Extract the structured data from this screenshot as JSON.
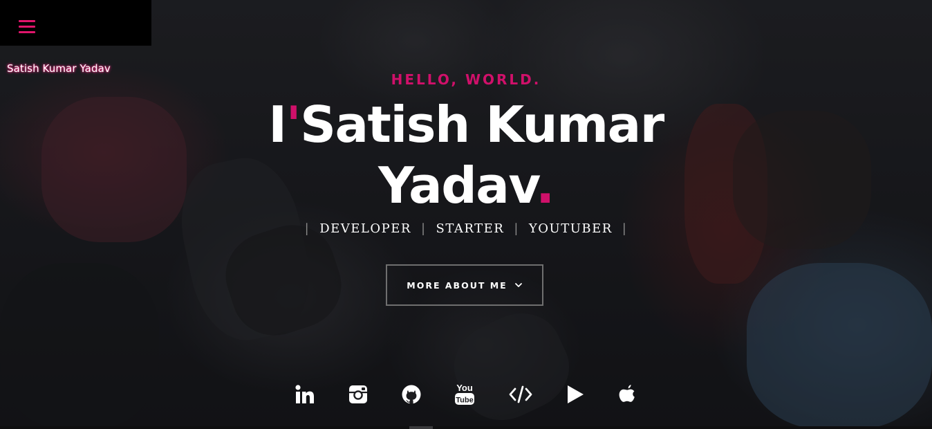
{
  "menu": {
    "icon": "hamburger-menu-icon",
    "accent_color": "#e0156b"
  },
  "brand": {
    "name": "Satish Kumar Yadav"
  },
  "hero": {
    "greeting": "HELLO, WORLD.",
    "headline_prefix": "I",
    "headline_apostrophe": "'",
    "headline_line1_rest": "Satish Kumar",
    "headline_line2": "Yadav",
    "headline_dot": ".",
    "accent_color": "#d0106a",
    "roles": [
      "DEVELOPER",
      "STARTER",
      "YOUTUBER"
    ],
    "roles_separator": "|",
    "cta_label": "MORE ABOUT ME"
  },
  "socials": [
    {
      "name": "linkedin",
      "icon": "linkedin-icon"
    },
    {
      "name": "instagram",
      "icon": "instagram-icon"
    },
    {
      "name": "github",
      "icon": "github-icon"
    },
    {
      "name": "youtube",
      "icon": "youtube-icon",
      "label_top": "You",
      "label_bottom": "Tube"
    },
    {
      "name": "code",
      "icon": "code-icon"
    },
    {
      "name": "play",
      "icon": "play-icon"
    },
    {
      "name": "apple",
      "icon": "apple-icon"
    }
  ]
}
